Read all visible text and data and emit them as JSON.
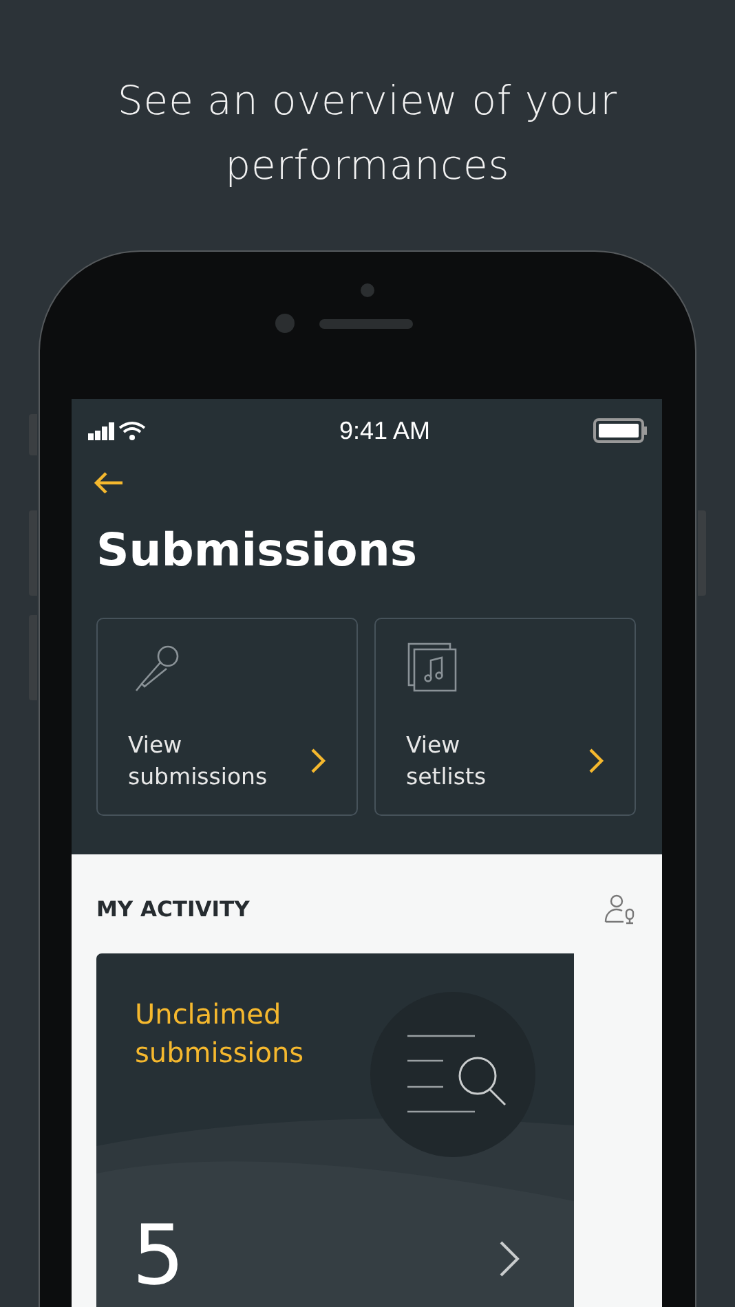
{
  "headline": "See an overview of your performances",
  "status_bar": {
    "time": "9:41 AM"
  },
  "title": "Submissions",
  "shortcuts": [
    {
      "kind": "microphone",
      "line1": "View",
      "line2": "submissions"
    },
    {
      "kind": "setlist",
      "line1": "View",
      "line2": "setlists"
    }
  ],
  "activity": {
    "heading": "MY ACTIVITY",
    "card": {
      "title": "Unclaimed submissions",
      "count": "5"
    }
  }
}
